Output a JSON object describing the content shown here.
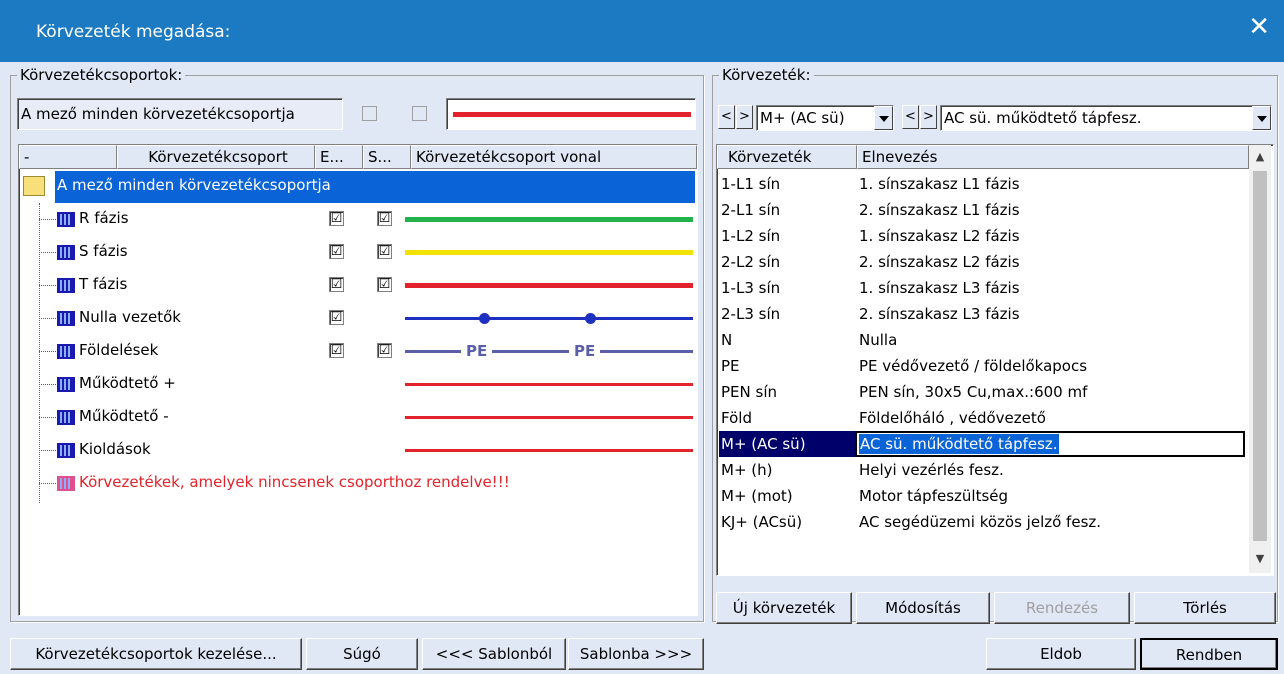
{
  "window": {
    "title": "Körvezeték megadása:"
  },
  "left_group": {
    "legend": "Körvezetékcsoportok:",
    "field_value": "A mező minden körvezetékcsoportja",
    "columns": [
      "-",
      "Körvezetékcsoport",
      "E...",
      "S...",
      "Körvezetékcsoport vonal"
    ],
    "root_label": "A mező minden körvezetékcsoportja",
    "rows": [
      {
        "label": "R fázis",
        "e": "☑",
        "s": "☑",
        "line_color": "#21b24b"
      },
      {
        "label": "S fázis",
        "e": "☑",
        "s": "☑",
        "line_color": "#f2e200"
      },
      {
        "label": "T fázis",
        "e": "☑",
        "s": "☑",
        "line_color": "#e3232b"
      },
      {
        "label": "Nulla vezetők",
        "e": "☑",
        "s": "",
        "line_color": "#1f2fc0"
      },
      {
        "label": "Földelések",
        "e": "☑",
        "s": "☑",
        "line_color": "#5a5fa8",
        "pe_text": "PE"
      },
      {
        "label": "Működtető +",
        "e": "",
        "s": "",
        "line_color": "#e3232b"
      },
      {
        "label": "Működtető -",
        "e": "",
        "s": "",
        "line_color": "#e3232b"
      },
      {
        "label": "Kioldások",
        "e": "",
        "s": "",
        "line_color": "#e3232b"
      }
    ],
    "unassigned_label": "Körvezetékek, amelyek nincsenek csoporthoz rendelve!!!"
  },
  "right_group": {
    "legend": "Körvezeték:",
    "combo1_value": "M+ (AC sü)",
    "combo2_value": "AC sü. működtető tápfesz.",
    "columns": [
      "Körvezeték",
      "Elnevezés"
    ],
    "rows": [
      {
        "code": "1-L1 sín",
        "name": "1. sínszakasz L1 fázis"
      },
      {
        "code": "2-L1 sín",
        "name": "2. sínszakasz L1 fázis"
      },
      {
        "code": "1-L2 sín",
        "name": "1. sínszakasz L2 fázis"
      },
      {
        "code": "2-L2 sín",
        "name": "2. sínszakasz L2 fázis"
      },
      {
        "code": "1-L3 sín",
        "name": "1. sínszakasz L3 fázis"
      },
      {
        "code": "2-L3 sín",
        "name": "2. sínszakasz L3 fázis"
      },
      {
        "code": "N",
        "name": "Nulla"
      },
      {
        "code": "PE",
        "name": "PE védővezető / földelőkapocs"
      },
      {
        "code": "PEN sín",
        "name": "PEN sín, 30x5 Cu,max.:600 mf"
      },
      {
        "code": "Föld",
        "name": "Földelőháló , védővezető"
      },
      {
        "code": "M+ (AC sü)",
        "name": "AC sü. működtető tápfesz."
      },
      {
        "code": "M+ (h)",
        "name": "Helyi vezérlés fesz."
      },
      {
        "code": "M+ (mot)",
        "name": "Motor tápfeszültség"
      },
      {
        "code": "KJ+ (ACsü)",
        "name": "AC segédüzemi közös jelző fesz."
      }
    ],
    "selected_index": 10,
    "buttons": {
      "new": "Új körvezeték",
      "modify": "Módosítás",
      "sort": "Rendezés",
      "delete": "Törlés"
    }
  },
  "bottom_buttons": {
    "manage": "Körvezetékcsoportok kezelése...",
    "help": "Súgó",
    "from_template": "<<< Sablonból",
    "to_template": "Sablonba >>>",
    "discard": "Eldob",
    "ok": "Rendben"
  },
  "colors": {
    "titlebar": "#1b7ac2",
    "selection": "#0a64d8",
    "selection_dark": "#00006a",
    "unassigned": "#e3232b"
  }
}
